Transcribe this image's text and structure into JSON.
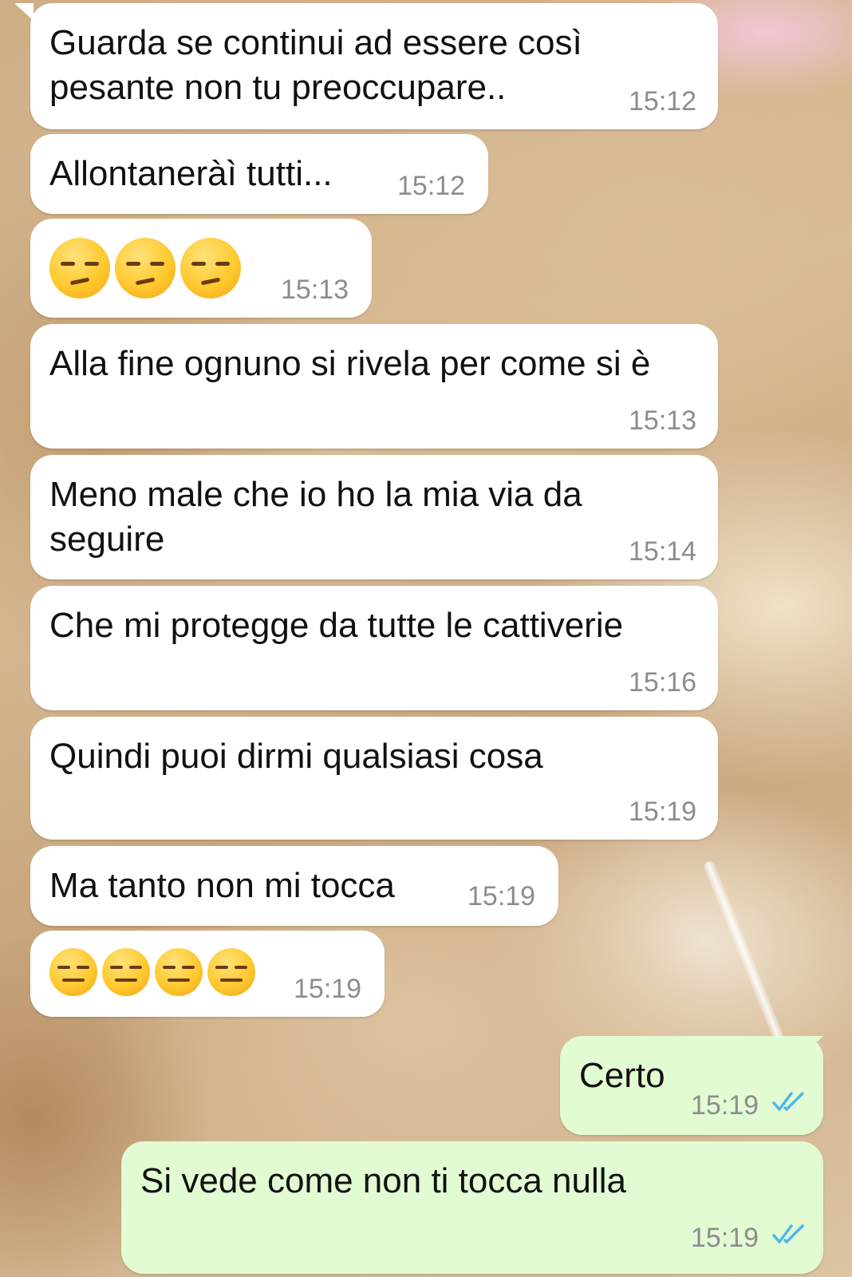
{
  "chat": {
    "messages": [
      {
        "id": 1,
        "direction": "in",
        "text": "Guarda se continui ad essere così\npesante non tu preoccupare..",
        "time": "15:12"
      },
      {
        "id": 2,
        "direction": "in",
        "text": "Allontaneràì tutti...",
        "time": "15:12"
      },
      {
        "id": 3,
        "direction": "in",
        "emoji": [
          "unamused-face-emoji",
          "unamused-face-emoji",
          "unamused-face-emoji"
        ],
        "time": "15:13"
      },
      {
        "id": 4,
        "direction": "in",
        "text": "Alla fine ognuno si rivela per come si è",
        "time": "15:13"
      },
      {
        "id": 5,
        "direction": "in",
        "text": "Meno male che io ho la mia via da\nseguire",
        "time": "15:14"
      },
      {
        "id": 6,
        "direction": "in",
        "text": "Che mi protegge da tutte le cattiverie",
        "time": "15:16"
      },
      {
        "id": 7,
        "direction": "in",
        "text": "Quindi puoi dirmi qualsiasi cosa",
        "time": "15:19"
      },
      {
        "id": 8,
        "direction": "in",
        "text": "Ma tanto non mi tocca",
        "time": "15:19"
      },
      {
        "id": 9,
        "direction": "in",
        "emoji": [
          "expressionless-face-emoji",
          "expressionless-face-emoji",
          "expressionless-face-emoji",
          "expressionless-face-emoji"
        ],
        "time": "15:19"
      },
      {
        "id": 10,
        "direction": "out",
        "text": "Certo",
        "time": "15:19",
        "status": "read-double-check-icon"
      },
      {
        "id": 11,
        "direction": "out",
        "text": "Si vede come non ti tocca nulla",
        "time": "15:19",
        "status": "read-double-check-icon"
      }
    ]
  },
  "colors": {
    "incoming_bubble": "#ffffff",
    "outgoing_bubble": "#e2fbd3",
    "timestamp": "#8d8d8d",
    "read_ticks": "#4fb6ec",
    "emoji_face": "#ffc92f"
  }
}
